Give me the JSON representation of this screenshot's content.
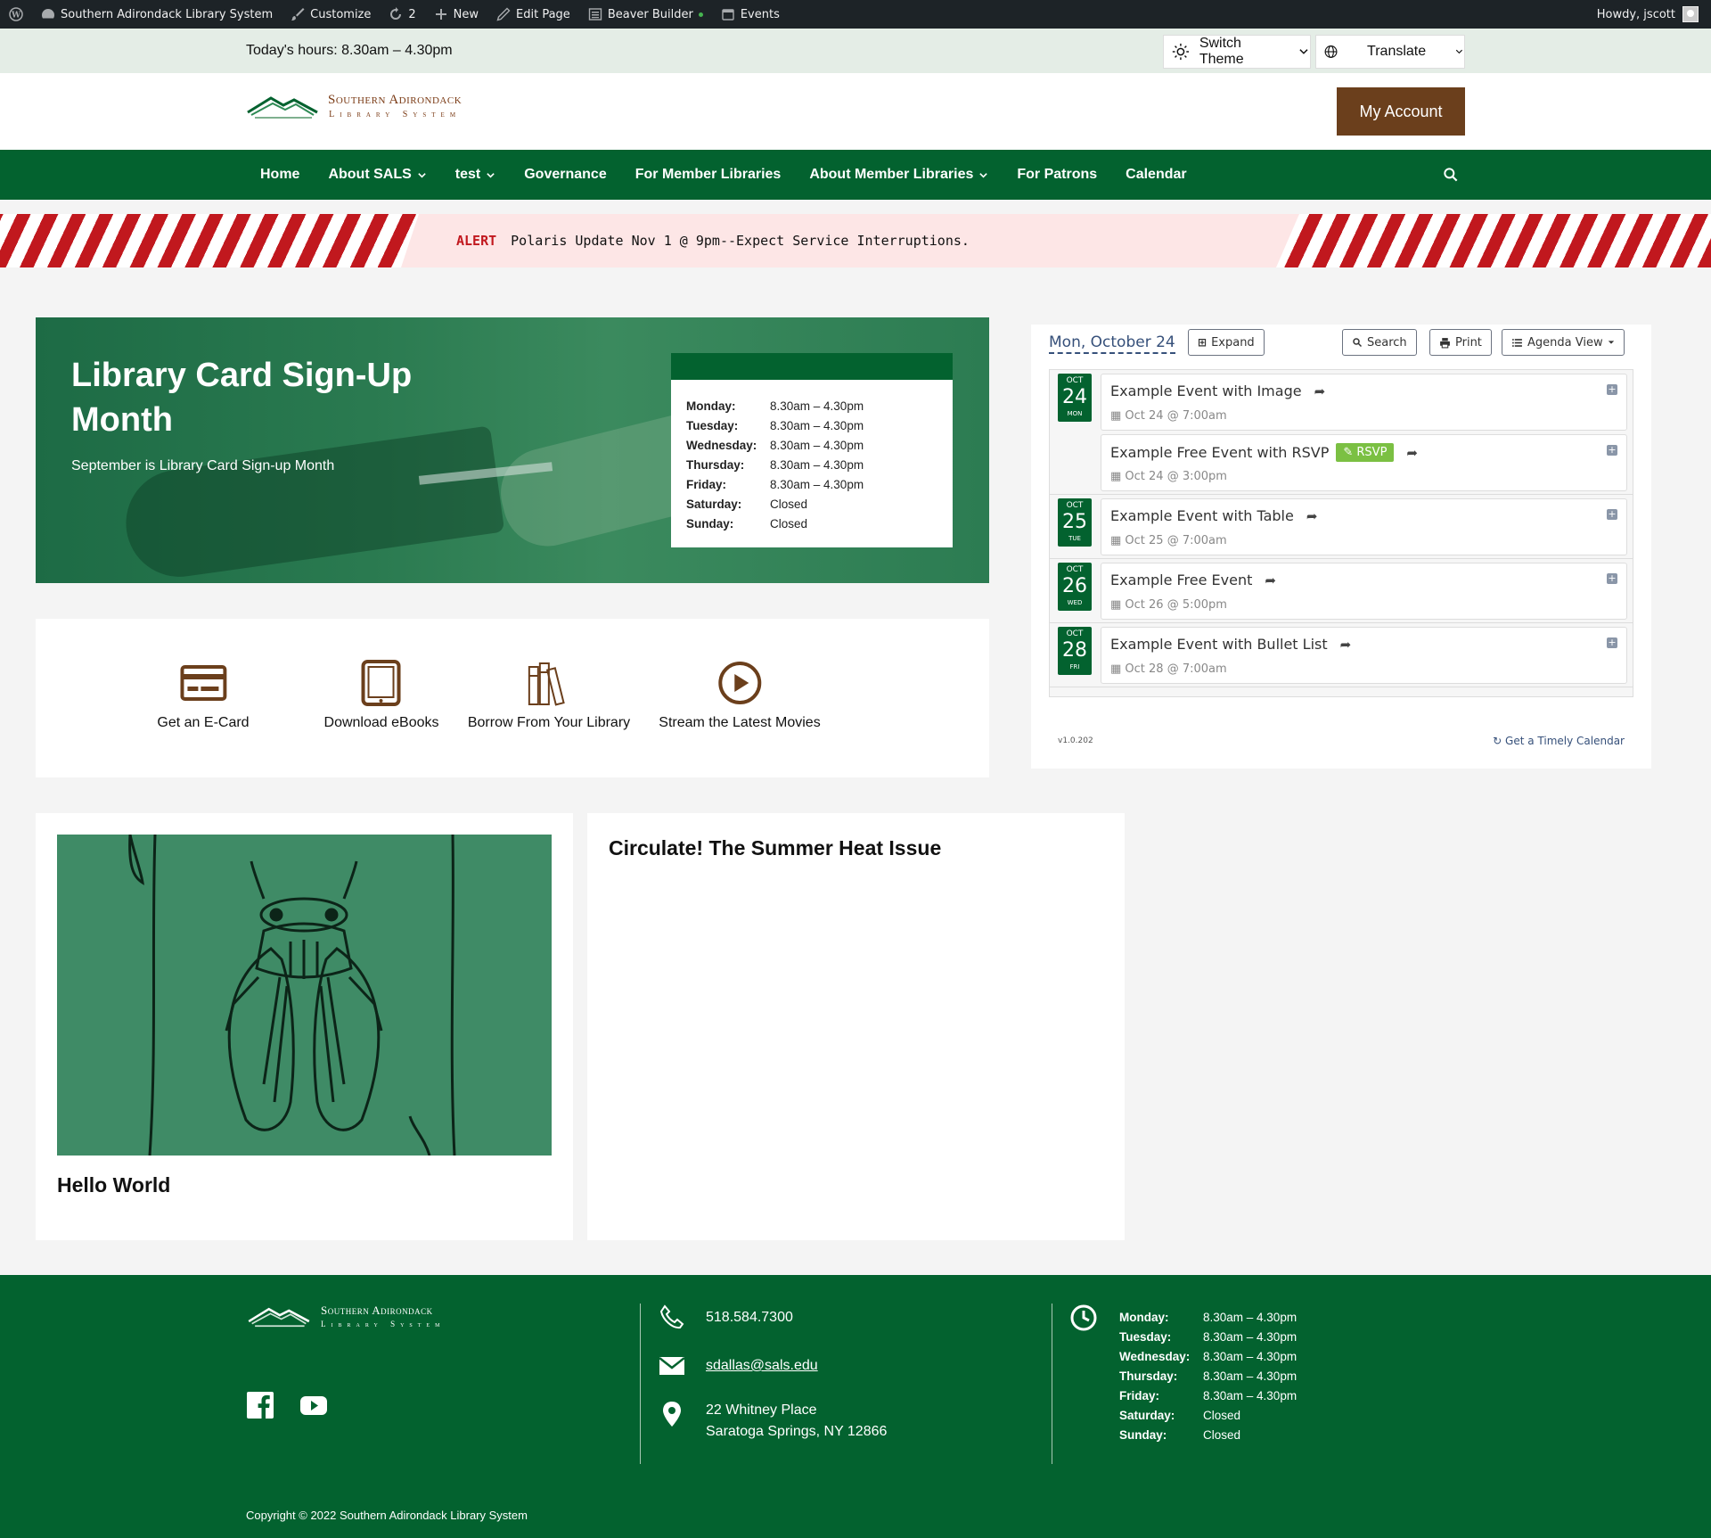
{
  "admin_bar": {
    "site_name": "Southern Adirondack Library System",
    "customize": "Customize",
    "updates_count": "2",
    "new_label": "New",
    "edit_page": "Edit Page",
    "beaver_builder": "Beaver Builder",
    "events": "Events",
    "howdy": "Howdy, jscott"
  },
  "utility": {
    "todays_hours": "Today's hours: 8.30am – 4.30pm",
    "switch_theme": "Switch Theme",
    "translate": "Translate"
  },
  "header": {
    "logo_line1": "Southern Adirondack",
    "logo_line2": "Library System",
    "my_account": "My Account"
  },
  "nav": {
    "items": [
      {
        "label": "Home",
        "dropdown": false
      },
      {
        "label": "About SALS",
        "dropdown": true
      },
      {
        "label": "test",
        "dropdown": true
      },
      {
        "label": "Governance",
        "dropdown": false
      },
      {
        "label": "For Member Libraries",
        "dropdown": false
      },
      {
        "label": "About Member Libraries",
        "dropdown": true
      },
      {
        "label": "For Patrons",
        "dropdown": false
      },
      {
        "label": "Calendar",
        "dropdown": false
      }
    ]
  },
  "alert": {
    "label": "ALERT",
    "message": "Polaris Update Nov 1 @ 9pm--Expect Service Interruptions."
  },
  "hero": {
    "title": "Library Card Sign-Up Month",
    "subtitle": "September is Library Card Sign-up Month",
    "hours": [
      {
        "day": "Monday:",
        "time": "8.30am – 4.30pm"
      },
      {
        "day": "Tuesday:",
        "time": "8.30am – 4.30pm"
      },
      {
        "day": "Wednesday:",
        "time": "8.30am – 4.30pm"
      },
      {
        "day": "Thursday:",
        "time": "8.30am – 4.30pm"
      },
      {
        "day": "Friday:",
        "time": "8.30am – 4.30pm"
      },
      {
        "day": "Saturday:",
        "time": "Closed"
      },
      {
        "day": "Sunday:",
        "time": "Closed"
      }
    ]
  },
  "quick_links": [
    {
      "label": "Get an E-Card",
      "icon": "card-icon"
    },
    {
      "label": "Download eBooks",
      "icon": "tablet-icon"
    },
    {
      "label": "Borrow From Your Library",
      "icon": "books-icon"
    },
    {
      "label": "Stream the Latest Movies",
      "icon": "play-icon"
    }
  ],
  "calendar": {
    "current_date": "Mon, October 24",
    "expand": "Expand",
    "search": "Search",
    "print": "Print",
    "view": "Agenda View",
    "days": [
      {
        "month": "OCT",
        "day": "24",
        "weekday": "MON",
        "events": [
          {
            "title": "Example Event with Image",
            "time": "Oct 24 @ 7:00am",
            "rsvp": ""
          },
          {
            "title": "Example Free Event with RSVP",
            "time": "Oct 24 @ 3:00pm",
            "rsvp": "RSVP"
          }
        ]
      },
      {
        "month": "OCT",
        "day": "25",
        "weekday": "TUE",
        "events": [
          {
            "title": "Example Event with Table",
            "time": "Oct 25 @ 7:00am",
            "rsvp": ""
          }
        ]
      },
      {
        "month": "OCT",
        "day": "26",
        "weekday": "WED",
        "events": [
          {
            "title": "Example Free Event",
            "time": "Oct 26 @ 5:00pm",
            "rsvp": ""
          }
        ]
      },
      {
        "month": "OCT",
        "day": "28",
        "weekday": "FRI",
        "events": [
          {
            "title": "Example Event with Bullet List",
            "time": "Oct 28 @ 7:00am",
            "rsvp": ""
          }
        ]
      }
    ],
    "version": "v1.0.202",
    "powered_by": "Get a Timely Calendar"
  },
  "posts": [
    {
      "title": "Hello World"
    },
    {
      "title": "Circulate! The Summer Heat Issue"
    }
  ],
  "footer": {
    "phone": "518.584.7300",
    "email": "sdallas@sals.edu",
    "address_line1": "22 Whitney Place",
    "address_line2": "Saratoga Springs, NY 12866",
    "hours": [
      {
        "day": "Monday:",
        "time": "8.30am – 4.30pm"
      },
      {
        "day": "Tuesday:",
        "time": "8.30am – 4.30pm"
      },
      {
        "day": "Wednesday:",
        "time": "8.30am – 4.30pm"
      },
      {
        "day": "Thursday:",
        "time": "8.30am – 4.30pm"
      },
      {
        "day": "Friday:",
        "time": "8.30am – 4.30pm"
      },
      {
        "day": "Saturday:",
        "time": "Closed"
      },
      {
        "day": "Sunday:",
        "time": "Closed"
      }
    ],
    "copyright": "Copyright © 2022 Southern Adirondack Library System"
  },
  "colors": {
    "brand_green": "#03622f",
    "brand_brown": "#6b3f1c",
    "alert_red": "#c1181e",
    "rsvp_green": "#7bc043"
  }
}
